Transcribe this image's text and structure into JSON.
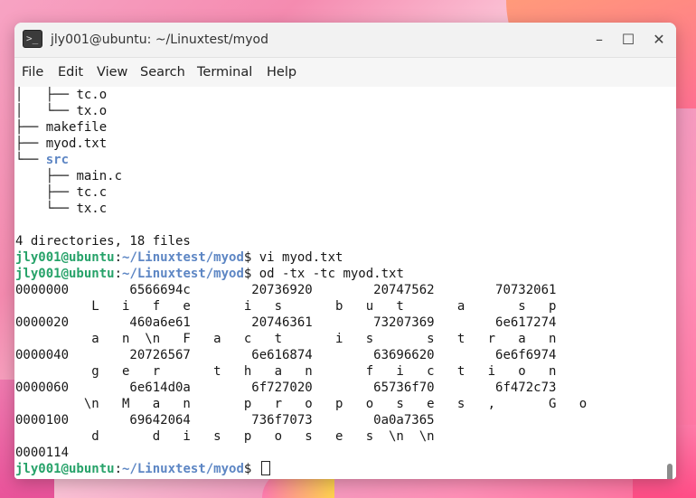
{
  "window": {
    "title": "jly001@ubuntu: ~/Linuxtest/myod",
    "app_icon": ">_",
    "buttons": {
      "minimize": "–",
      "maximize": "☐",
      "close": "✕"
    }
  },
  "menu": {
    "items": [
      "File",
      "Edit",
      "View",
      "Search",
      "Terminal",
      "Help"
    ]
  },
  "terminal": {
    "tree": [
      {
        "prefix": "│   ├── ",
        "name": "tc.o",
        "is_dir": false
      },
      {
        "prefix": "│   └── ",
        "name": "tx.o",
        "is_dir": false
      },
      {
        "prefix": "├── ",
        "name": "makefile",
        "is_dir": false
      },
      {
        "prefix": "├── ",
        "name": "myod.txt",
        "is_dir": false
      },
      {
        "prefix": "└── ",
        "name": "src",
        "is_dir": true
      },
      {
        "prefix": "    ├── ",
        "name": "main.c",
        "is_dir": false
      },
      {
        "prefix": "    ├── ",
        "name": "tc.c",
        "is_dir": false
      },
      {
        "prefix": "    └── ",
        "name": "tx.c",
        "is_dir": false
      }
    ],
    "summary": "4 directories, 18 files",
    "prompt_user": "jly001@ubuntu",
    "prompt_path": "~/Linuxtest/myod",
    "prompt_sep": ":",
    "prompt_end": "$ ",
    "commands": [
      "vi myod.txt",
      "od -tx -tc myod.txt"
    ],
    "od_output": [
      "0000000        6566694c        20736920        20747562        70732061",
      "          L   i   f   e       i   s       b   u   t       a       s   p",
      "0000020        460a6e61        20746361        73207369        6e617274",
      "          a   n  \\n   F   a   c   t       i   s       s   t   r   a   n",
      "0000040        20726567        6e616874        63696620        6e6f6974",
      "          g   e   r       t   h   a   n       f   i   c   t   i   o   n",
      "0000060        6e614d0a        6f727020        65736f70        6f472c73",
      "         \\n   M   a   n       p   r   o   p   o   s   e   s   ,       G   o",
      "0000100        69642064        736f7073        0a0a7365",
      "          d       d   i   s   p   o   s   e   s  \\n  \\n",
      "0000114"
    ]
  }
}
